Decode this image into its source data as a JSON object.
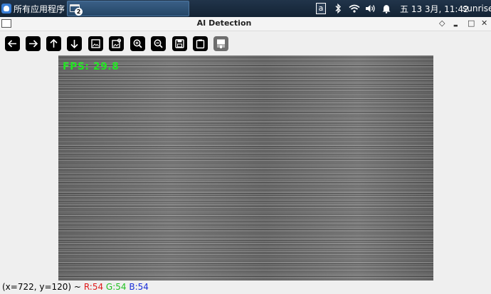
{
  "panel": {
    "apps_menu_label": "所有应用程序",
    "separator": "⁝",
    "task_count": "2",
    "keyboard_indicator": "a",
    "clock": "五 13 3月, 11:42",
    "user": "sunrise"
  },
  "window": {
    "title": "AI Detection",
    "controls": {
      "more": "◇",
      "minimize": "▬",
      "maximize": "□",
      "close": "✕"
    }
  },
  "toolbar": {
    "buttons": [
      "back",
      "forward",
      "up",
      "down",
      "image",
      "image-settings",
      "zoom-in",
      "zoom-out",
      "save",
      "clipboard",
      "properties"
    ]
  },
  "video": {
    "fps_text": "FPS: 29.8"
  },
  "status": {
    "position": "(x=722, y=120) ~",
    "r": "R:54",
    "g": "G:54",
    "b": "B:54"
  }
}
